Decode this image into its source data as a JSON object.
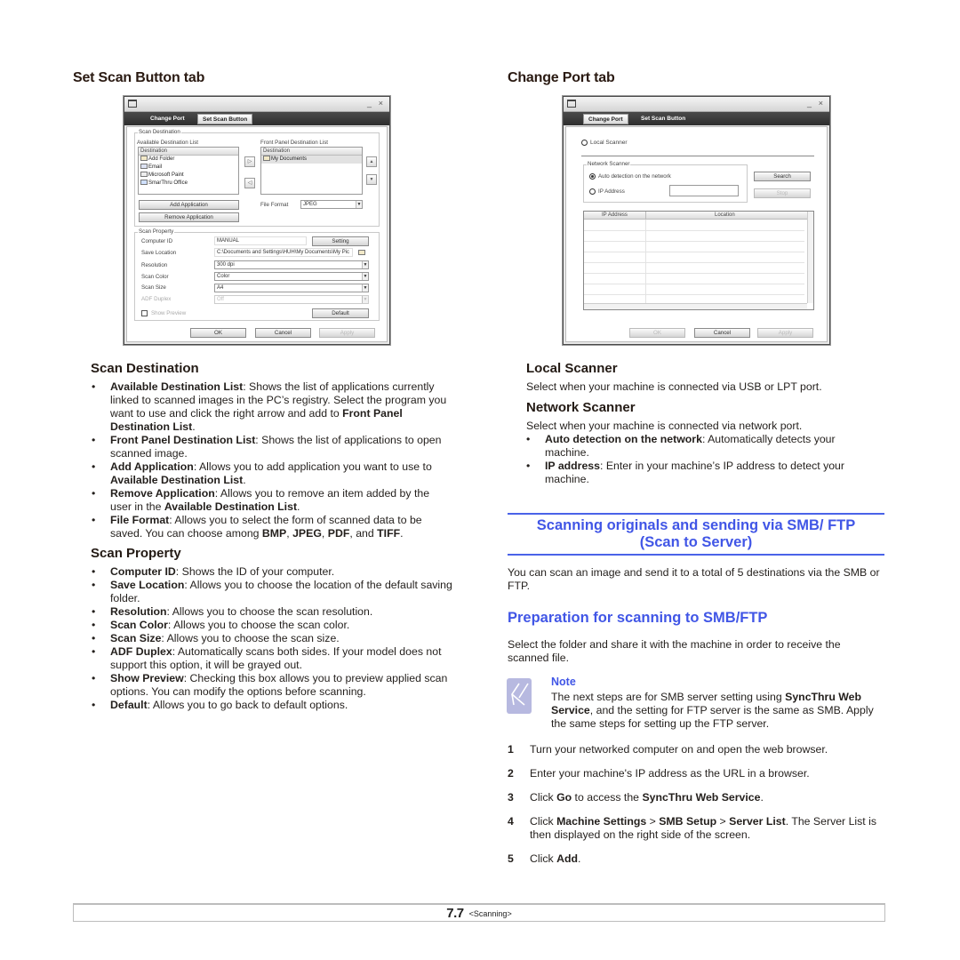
{
  "left_column": {
    "tab_heading": "Set Scan Button tab",
    "dialog": {
      "title_controls": {
        "minimize": "_",
        "close": "×"
      },
      "tabs": [
        {
          "label": "Change Port",
          "active": false
        },
        {
          "label": "Set Scan Button",
          "active": true
        }
      ],
      "scan_destination": {
        "group_label": "Scan Destination",
        "available_label": "Available Destination List",
        "available_header": "Destination",
        "available_items": [
          "Add Folder",
          "Email",
          "Microsoft Paint",
          "SmarThru Office"
        ],
        "front_panel_label": "Front Panel Destination List",
        "front_panel_header": "Destination",
        "front_panel_items": [
          "My Documents"
        ],
        "add_application": "Add Application",
        "remove_application": "Remove Application",
        "file_format_label": "File Format",
        "file_format_value": "JPEG",
        "arrow_right": "▷",
        "arrow_left": "◁",
        "move_up": "▲",
        "move_down": "▼"
      },
      "scan_property": {
        "group_label": "Scan Property",
        "computer_id_label": "Computer ID",
        "computer_id_value": "MANUAL",
        "setting_button": "Setting",
        "save_location_label": "Save Location",
        "save_location_value": "C:\\Documents and Settings\\HUH\\My Documents\\My Pic",
        "resolution_label": "Resolution",
        "resolution_value": "300 dpi",
        "scan_color_label": "Scan Color",
        "scan_color_value": "Color",
        "scan_size_label": "Scan Size",
        "scan_size_value": "A4",
        "adf_duplex_label": "ADF Duplex",
        "adf_duplex_value": "Off",
        "show_preview_label": "Show Preview",
        "default_button": "Default"
      },
      "buttons": {
        "ok": "OK",
        "cancel": "Cancel",
        "apply": "Apply"
      }
    },
    "scan_destination_section": {
      "heading": "Scan Destination",
      "items": [
        {
          "term": "Available Destination List",
          "text": ": Shows the list of applications currently linked to scanned images in the PC’s registry. Select the program you want to use and click the right arrow and add to ",
          "term2": "Front Panel Destination List",
          "text2": "."
        },
        {
          "term": "Front Panel Destination List",
          "text": ": Shows the list of applications to open scanned image.",
          "term2": "",
          "text2": ""
        },
        {
          "term": "Add Application",
          "text": ": Allows you to add application you want to use to ",
          "term2": "Available Destination List",
          "text2": "."
        },
        {
          "term": "Remove Application",
          "text": ": Allows you to remove an item added by the user in the ",
          "term2": "Available Destination List",
          "text2": "."
        }
      ],
      "file_format": {
        "term": "File Format",
        "text": ": Allows you to select the form of scanned data to be saved. You can choose among ",
        "formats": [
          "BMP",
          "JPEG",
          "PDF",
          "TIFF"
        ],
        "sep1": ", ",
        "sep2": ", ",
        "sep3": ", and ",
        "end": "."
      }
    },
    "scan_property_section": {
      "heading": "Scan Property",
      "items": [
        {
          "term": "Computer ID",
          "text": ": Shows the ID of your computer."
        },
        {
          "term": "Save Location",
          "text": ": Allows you to choose the location of the default saving folder."
        },
        {
          "term": "Resolution",
          "text": ": Allows you to choose the scan resolution."
        },
        {
          "term": "Scan Color",
          "text": ": Allows you to choose the scan color."
        },
        {
          "term": "Scan Size",
          "text": ": Allows you to choose the scan size."
        },
        {
          "term": "ADF Duplex",
          "text": ": Automatically scans both sides. If your model does not support this option, it will be grayed out."
        },
        {
          "term": "Show Preview",
          "text": ": Checking this box allows you to preview applied scan options. You can modify the options before scanning."
        },
        {
          "term": "Default",
          "text": ": Allows you to go back to default options."
        }
      ]
    }
  },
  "right_column": {
    "tab_heading": "Change Port tab",
    "dialog": {
      "title_controls": {
        "minimize": "_",
        "close": "×"
      },
      "tabs": [
        {
          "label": "Change Port",
          "active": true
        },
        {
          "label": "Set Scan Button",
          "active": false
        }
      ],
      "local_scanner_label": "Local Scanner",
      "network_group_label": "Network Scanner",
      "auto_detection_label": "Auto detection on the network",
      "ip_address_label": "IP Address",
      "ip_address_value": "",
      "search_button": "Search",
      "stop_button": "Stop",
      "table_headers": [
        "IP Address",
        "Location"
      ],
      "buttons": {
        "ok": "OK",
        "cancel": "Cancel",
        "apply": "Apply"
      }
    },
    "local_scanner_section": {
      "heading": "Local Scanner",
      "text": "Select when your machine is connected via USB or LPT port."
    },
    "network_scanner_section": {
      "heading": "Network Scanner",
      "text": "Select when your machine is connected via network port.",
      "items": [
        {
          "term": "Auto detection on the network",
          "text": ": Automatically detects your machine."
        },
        {
          "term": "IP address",
          "text": ": Enter in your machine’s IP address to detect your machine."
        }
      ]
    },
    "banner": {
      "line1": "Scanning originals and sending via SMB/ FTP",
      "line2": "(Scan to Server)"
    },
    "banner_intro": "You can scan an image and send it to a total of 5 destinations via the SMB or FTP.",
    "preparation": {
      "heading": "Preparation for scanning to SMB/FTP",
      "text": "Select the folder and share it with the machine in order to receive the scanned file."
    },
    "note": {
      "title": "Note",
      "t1": "The next steps are for SMB server setting using ",
      "b1": "SyncThru Web Service",
      "t2": ", and the setting for FTP server is the same as SMB. Apply the same steps for setting up the FTP server."
    },
    "steps": [
      {
        "num": "1",
        "parts": [
          {
            "t": "Turn your networked computer on and open the web browser.",
            "b": false
          }
        ]
      },
      {
        "num": "2",
        "parts": [
          {
            "t": "Enter your machine's IP address as the URL in a browser.",
            "b": false
          }
        ]
      },
      {
        "num": "3",
        "parts": [
          {
            "t": "Click ",
            "b": false
          },
          {
            "t": "Go",
            "b": true
          },
          {
            "t": " to access the ",
            "b": false
          },
          {
            "t": "SyncThru Web Service",
            "b": true
          },
          {
            "t": ".",
            "b": false
          }
        ]
      },
      {
        "num": "4",
        "parts": [
          {
            "t": "Click ",
            "b": false
          },
          {
            "t": "Machine Settings",
            "b": true
          },
          {
            "t": " > ",
            "b": false
          },
          {
            "t": "SMB Setup",
            "b": true
          },
          {
            "t": " > ",
            "b": false
          },
          {
            "t": "Server List",
            "b": true
          },
          {
            "t": ". The Server List is then displayed on the right side of the screen.",
            "b": false
          }
        ]
      },
      {
        "num": "5",
        "parts": [
          {
            "t": "Click ",
            "b": false
          },
          {
            "t": "Add",
            "b": true
          },
          {
            "t": ".",
            "b": false
          }
        ]
      }
    ]
  },
  "footer": {
    "page_number": "7.7",
    "chapter": "<Scanning>"
  },
  "colors": {
    "accent_blue": "#4156e6",
    "text": "#231f1c"
  }
}
